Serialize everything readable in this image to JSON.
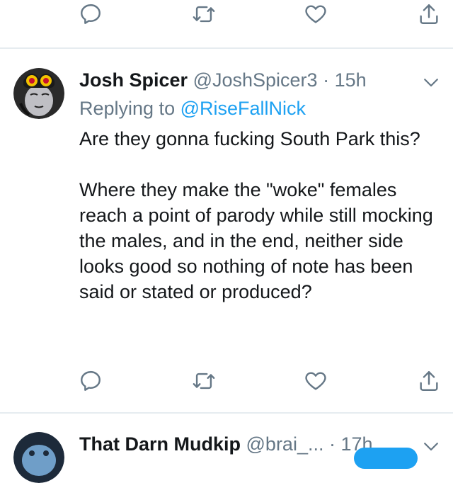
{
  "tweet": {
    "author_name": "Josh Spicer",
    "author_handle": "@JoshSpicer3",
    "separator": "·",
    "time": "15h",
    "reply_prefix": "Replying to",
    "reply_mention": "@RiseFallNick",
    "paragraphs": [
      "Are they gonna fucking South Park this?",
      "Where they make the \"woke\" females reach a point of parody while still mocking the males, and in the end, neither side looks good so nothing of note has been said or stated or produced?"
    ]
  },
  "next_tweet": {
    "author_name": "That Darn Mudkip",
    "author_handle": "@brai_...",
    "separator": "·",
    "time": "17h"
  },
  "icons": {
    "reply": "reply-icon",
    "retweet": "retweet-icon",
    "like": "heart-icon",
    "share": "share-icon",
    "menu": "chevron-down-icon"
  },
  "colors": {
    "icon": "#657786",
    "link": "#1da1f2",
    "text": "#14171a",
    "divider": "#e6ecf0"
  }
}
